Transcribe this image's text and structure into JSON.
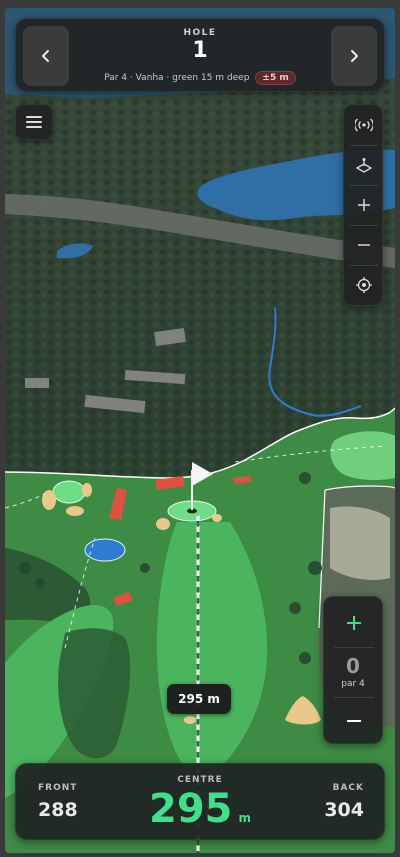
{
  "hole": {
    "label": "HOLE",
    "number": "1",
    "info": "Par 4 · Vanha · green 15 m deep",
    "accuracy": "±5 m",
    "prev_icon": "chevron-left-icon",
    "next_icon": "chevron-right-icon"
  },
  "toolbar": {
    "items": [
      {
        "icon": "gps-signal-icon"
      },
      {
        "icon": "tilt-view-icon"
      },
      {
        "icon": "plus-icon"
      },
      {
        "icon": "minus-icon"
      },
      {
        "icon": "locate-icon"
      }
    ]
  },
  "menu": {
    "icon": "menu-icon"
  },
  "score": {
    "value": "0",
    "sub": "par 4",
    "plus_icon": "plus-icon",
    "minus_icon": "minus-icon"
  },
  "callout": {
    "distance": "295 m"
  },
  "distances": {
    "front_label": "FRONT",
    "front_value": "288",
    "centre_label": "CENTRE",
    "centre_value": "295",
    "centre_unit": "m",
    "back_label": "BACK",
    "back_value": "304"
  },
  "colors": {
    "accent_green": "#3fe08a",
    "panel_bg": "#202222",
    "fairway": "#4aa95e",
    "rough": "#3f8a45",
    "water": "#2f7bd1",
    "bunker": "#e8c98a",
    "out_of_bounds": "#e0523f"
  }
}
